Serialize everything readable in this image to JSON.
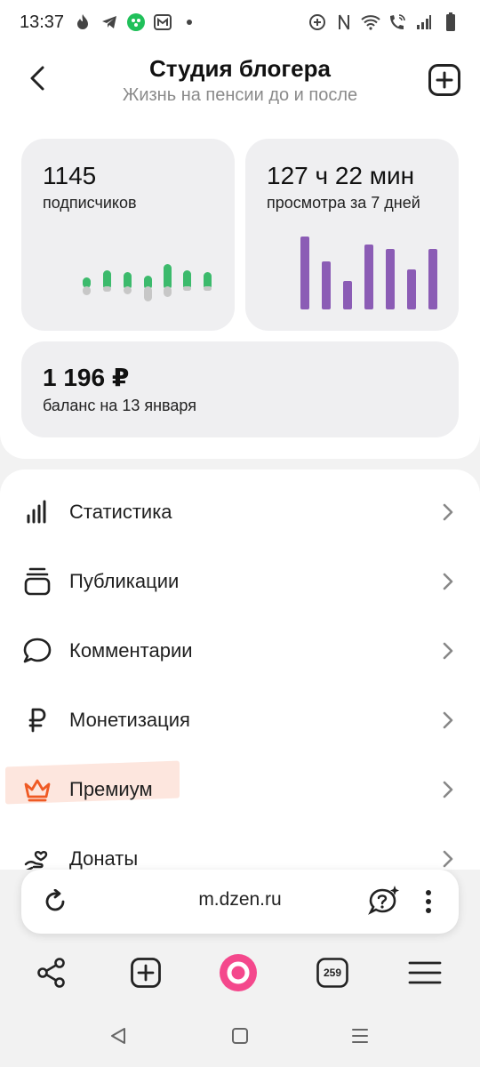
{
  "status_bar": {
    "time": "13:37"
  },
  "header": {
    "title": "Студия блогера",
    "subtitle": "Жизнь на пенсии до и после"
  },
  "stats": {
    "subscribers": {
      "value": "1145",
      "label": "подписчиков"
    },
    "views": {
      "value": "127 ч 22 мин",
      "label": "просмотра за 7 дней"
    },
    "balance": {
      "value": "1 196 ₽",
      "label": "баланс на 13 января"
    }
  },
  "menu": {
    "items": [
      {
        "label": "Статистика",
        "icon": "bar-chart-icon"
      },
      {
        "label": "Публикации",
        "icon": "stack-icon"
      },
      {
        "label": "Комментарии",
        "icon": "speech-bubble-icon"
      },
      {
        "label": "Монетизация",
        "icon": "ruble-icon"
      },
      {
        "label": "Премиум",
        "icon": "crown-icon"
      },
      {
        "label": "Донаты",
        "icon": "donation-icon"
      }
    ]
  },
  "browser": {
    "url": "m.dzen.ru",
    "tab_count": "259"
  },
  "colors": {
    "accent_green": "#3cba6c",
    "accent_purple": "#8b5cb5",
    "premium_orange": "#ef5a24",
    "alice_pink": "#f4488c"
  }
}
